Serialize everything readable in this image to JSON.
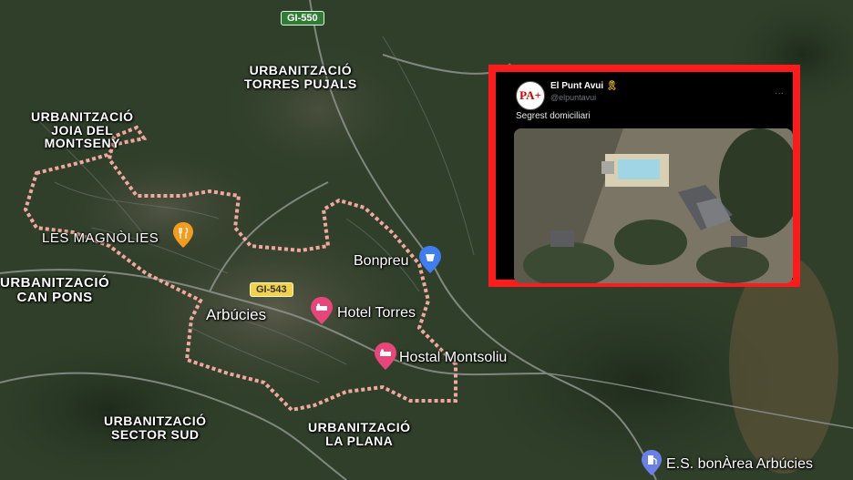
{
  "map": {
    "labels": [
      {
        "id": "torres-pujals",
        "lines": [
          "URBANITZACIÓ",
          "TORRES PUJALS"
        ]
      },
      {
        "id": "joia",
        "lines": [
          "URBANITZACIÓ",
          "JOIA DEL",
          "MONTSENY"
        ]
      },
      {
        "id": "les-magnolies",
        "lines": [
          "LES MAGNÒLIES"
        ]
      },
      {
        "id": "can-pons",
        "lines": [
          "URBANITZACIÓ",
          "CAN PONS"
        ]
      },
      {
        "id": "sector-sud",
        "lines": [
          "URBANITZACIÓ",
          "SECTOR SUD"
        ]
      },
      {
        "id": "la-plana",
        "lines": [
          "URBANITZACIÓ",
          "LA PLANA"
        ]
      }
    ],
    "town": "Arbúcies",
    "roads": {
      "gi550": "GI-550",
      "gi543": "GI-543"
    },
    "pois": {
      "bonpreu": "Bonpreu",
      "hotel_torres": "Hotel Torres",
      "hostal": "Hostal Montsoliu",
      "gas": "E.S. bonÀrea Arbúcies"
    },
    "colors": {
      "boundary": "#f0a8a0",
      "hotel_pin": "#e8457a",
      "shop_pin": "#3f7ef0",
      "food_pin": "#f29c1f",
      "gas_pin": "#6b7fe8"
    }
  },
  "tweet": {
    "avatar_text": "PA+",
    "name": "El Punt Avui",
    "verified_symbol": "🎗",
    "handle": "@elpuntavui",
    "menu": "···",
    "text": "Segrest domiciliari"
  }
}
